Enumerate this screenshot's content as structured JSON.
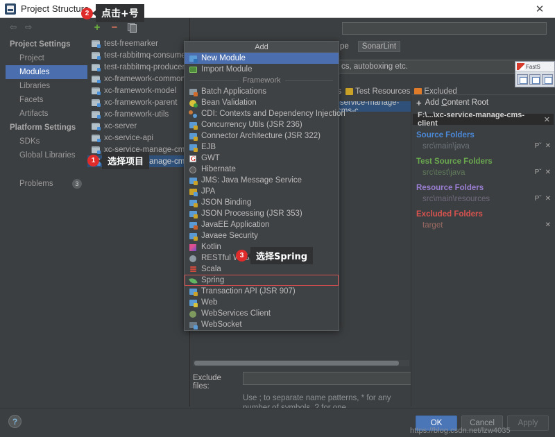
{
  "window": {
    "title": "Project Structure",
    "app_icon": "intellij-idea-icon",
    "close_label": "✕"
  },
  "sidebar": {
    "nav_back": "⇦",
    "nav_forward": "⇨",
    "groups": [
      {
        "label": "Project Settings",
        "items": [
          {
            "label": "Project",
            "selected": false
          },
          {
            "label": "Modules",
            "selected": true
          },
          {
            "label": "Libraries",
            "selected": false
          },
          {
            "label": "Facets",
            "selected": false
          },
          {
            "label": "Artifacts",
            "selected": false
          }
        ]
      },
      {
        "label": "Platform Settings",
        "items": [
          {
            "label": "SDKs",
            "selected": false
          },
          {
            "label": "Global Libraries",
            "selected": false
          }
        ]
      }
    ],
    "problems": {
      "label": "Problems",
      "count": "3"
    }
  },
  "modules": {
    "toolbar": {
      "add": "+",
      "remove": "−",
      "copy": "copy-icon"
    },
    "items": [
      {
        "label": "test-freemarker",
        "selected": false
      },
      {
        "label": "test-rabbitmq-consumer",
        "selected": false
      },
      {
        "label": "test-rabbitmq-producer",
        "selected": false
      },
      {
        "label": "xc-framework-common",
        "selected": false
      },
      {
        "label": "xc-framework-model",
        "selected": false
      },
      {
        "label": "xc-framework-parent",
        "selected": false
      },
      {
        "label": "xc-framework-utils",
        "selected": false
      },
      {
        "label": "xc-server",
        "selected": false
      },
      {
        "label": "xc-service-api",
        "selected": false
      },
      {
        "label": "xc-service-manage-cms",
        "selected": false
      },
      {
        "label": "xc-service-manage-cms-client",
        "selected": true
      }
    ]
  },
  "main": {
    "search_placeholder": "",
    "search_value": "",
    "tabs": [
      {
        "label": "pe",
        "selected": false
      },
      {
        "label": "SonarLint",
        "selected": true
      }
    ],
    "language_level": "cs, autoboxing etc.",
    "legend": [
      {
        "label": "es",
        "color": "#9aa7ae"
      },
      {
        "label": "Test Resources",
        "color": "#c9a227"
      },
      {
        "label": "Excluded",
        "color": "#e07b2a"
      }
    ],
    "path_strip": "-service-manage-cms-c",
    "exclude": {
      "label": "Exclude files:",
      "value": "",
      "hint": "Use ; to separate name patterns, * for any number of symbols, ? for one."
    }
  },
  "content_root": {
    "add_label_pre": "Add ",
    "add_label_key": "C",
    "add_label_post": "ontent Root",
    "add_plus": "+",
    "root_path": "F:\\...\\xc-service-manage-cms-client",
    "root_close": "✕",
    "groups": [
      {
        "title": "Source Folders",
        "title_color": "#4a88d8",
        "rows": [
          {
            "value": "src\\main\\java",
            "actions": [
              "Pˇ",
              "✕"
            ]
          }
        ]
      },
      {
        "title": "Test Source Folders",
        "title_color": "#6aa84f",
        "rows": [
          {
            "value": "src\\test\\java",
            "actions": [
              "Pˇ",
              "✕"
            ]
          }
        ]
      },
      {
        "title": "Resource Folders",
        "title_color": "#9b7fd4",
        "rows": [
          {
            "value": "src\\main\\resources",
            "actions": [
              "Pˇ",
              "✕"
            ]
          }
        ]
      },
      {
        "title": "Excluded Folders",
        "title_color": "#d9534f",
        "rows": [
          {
            "value": "target",
            "actions": [
              "✕"
            ]
          }
        ]
      }
    ]
  },
  "add_popup": {
    "title": "Add",
    "section_label": "Framework",
    "items": [
      {
        "label": "New Module",
        "icon": "module-icon",
        "selected": true
      },
      {
        "label": "Import Module",
        "icon": "import-icon",
        "selected": false
      },
      {
        "label": "Batch Applications",
        "icon": "batch-icon",
        "selected": false
      },
      {
        "label": "Bean Validation",
        "icon": "bean-validation-icon",
        "selected": false
      },
      {
        "label": "CDI: Contexts and Dependency Injection",
        "icon": "cdi-icon",
        "selected": false
      },
      {
        "label": "Concurrency Utils (JSR 236)",
        "icon": "concurrency-icon",
        "selected": false
      },
      {
        "label": "Connector Architecture (JSR 322)",
        "icon": "connector-icon",
        "selected": false
      },
      {
        "label": "EJB",
        "icon": "ejb-icon",
        "selected": false
      },
      {
        "label": "GWT",
        "icon": "gwt-icon",
        "selected": false
      },
      {
        "label": "Hibernate",
        "icon": "hibernate-icon",
        "selected": false
      },
      {
        "label": "JMS: Java Message Service",
        "icon": "jms-icon",
        "selected": false
      },
      {
        "label": "JPA",
        "icon": "jpa-icon",
        "selected": false
      },
      {
        "label": "JSON Binding",
        "icon": "json-binding-icon",
        "selected": false
      },
      {
        "label": "JSON Processing (JSR 353)",
        "icon": "json-processing-icon",
        "selected": false
      },
      {
        "label": "JavaEE Application",
        "icon": "javaee-icon",
        "selected": false
      },
      {
        "label": "Javaee Security",
        "icon": "javaee-security-icon",
        "selected": false
      },
      {
        "label": "Kotlin",
        "icon": "kotlin-icon",
        "selected": false
      },
      {
        "label": "RESTful Web Service",
        "icon": "restful-icon",
        "selected": false
      },
      {
        "label": "Scala",
        "icon": "scala-icon",
        "selected": false
      },
      {
        "label": "Spring",
        "icon": "spring-icon",
        "selected": false,
        "highlighted": true
      },
      {
        "label": "Transaction API (JSR 907)",
        "icon": "transaction-icon",
        "selected": false
      },
      {
        "label": "Web",
        "icon": "web-icon",
        "selected": false
      },
      {
        "label": "WebServices Client",
        "icon": "webservices-icon",
        "selected": false
      },
      {
        "label": "WebSocket",
        "icon": "websocket-icon",
        "selected": false
      }
    ]
  },
  "footer": {
    "help": "?",
    "ok": "OK",
    "cancel": "Cancel",
    "apply": "Apply"
  },
  "watermark": "https://blog.csdn.net/lzw4035",
  "annotations": [
    {
      "num": "1",
      "text": "选择项目"
    },
    {
      "num": "2",
      "text": "点击+号"
    },
    {
      "num": "3",
      "text": "选择Spring"
    }
  ],
  "capture_tool": {
    "title": "FastS"
  }
}
